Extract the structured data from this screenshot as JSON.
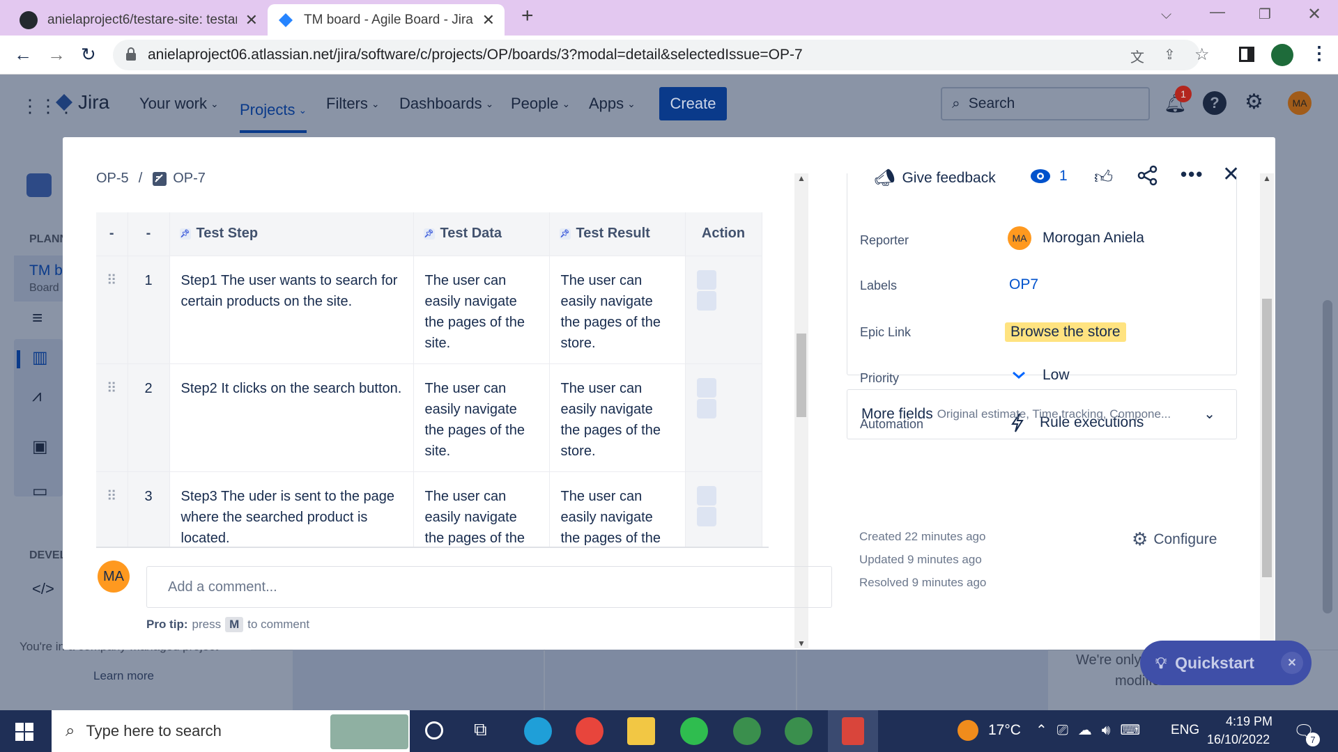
{
  "browser": {
    "tabs": [
      {
        "title": "anielaproject6/testare-site: testar",
        "active": false
      },
      {
        "title": "TM board - Agile Board - Jira",
        "active": true
      }
    ],
    "url": "anielaproject06.atlassian.net/jira/software/c/projects/OP/boards/3?modal=detail&selectedIssue=OP-7"
  },
  "jira_header": {
    "logo_text": "Jira",
    "nav": [
      "Your work",
      "Projects",
      "Filters",
      "Dashboards",
      "People",
      "Apps"
    ],
    "create_label": "Create",
    "search_placeholder": "Search",
    "notification_count": "1",
    "avatar_initials": "MA"
  },
  "sidebar_bg": {
    "planning_label": "PLANN",
    "board_title": "TM b",
    "board_sub": "Board",
    "dev_label": "DEVEL",
    "footer_text": "You're in a company-managed project",
    "learn_more": "Learn more"
  },
  "modal": {
    "breadcrumb_parent": "OP-5",
    "breadcrumb_sep": "/",
    "breadcrumb_issue": "OP-7",
    "give_feedback": "Give feedback",
    "watchers": "1",
    "table": {
      "headers": [
        "-",
        "-",
        "Test Step",
        "Test Data",
        "Test Result",
        "Action"
      ],
      "rows": [
        {
          "num": "1",
          "step": "Step1 The user wants to search for certain products on the site.",
          "data": "The user can easily navigate the pages of the site.",
          "result": "The user can easily navigate the pages of the store."
        },
        {
          "num": "2",
          "step": "Step2 It clicks on the search button.",
          "data": "The user can easily navigate the pages of the site.",
          "result": "The user can easily navigate the pages of the store."
        },
        {
          "num": "3",
          "step": "Step3 The uder is sent to the page where the searched product is located.",
          "data": "The user can easily navigate the pages of the",
          "result": "The user can easily navigate the pages of the"
        }
      ]
    },
    "comment": {
      "avatar": "MA",
      "placeholder": "Add a comment...",
      "protip_label": "Pro tip:",
      "protip_press": "press",
      "protip_key": "M",
      "protip_rest": "to comment"
    },
    "fields": {
      "reporter_label": "Reporter",
      "reporter_avatar": "MA",
      "reporter_value": "Morogan Aniela",
      "labels_label": "Labels",
      "labels_value": "OP7",
      "epic_label": "Epic Link",
      "epic_value": "Browse the store",
      "priority_label": "Priority",
      "priority_value": "Low",
      "automation_label": "Automation",
      "automation_value": "Rule executions"
    },
    "more_fields": {
      "title": "More fields",
      "hint": "Original estimate, Time tracking, Compone..."
    },
    "meta": {
      "created": "Created 22 minutes ago",
      "updated": "Updated 9 minutes ago",
      "resolved": "Resolved 9 minutes ago",
      "configure": "Configure"
    }
  },
  "quickstart": {
    "label": "Quickstart",
    "bg_text_1": "We're only",
    "bg_text_2": "modified issue."
  },
  "taskbar": {
    "search_placeholder": "Type here to search",
    "weather": "17°C",
    "lang": "ENG",
    "time": "4:19 PM",
    "date": "16/10/2022",
    "notification_count": "7"
  },
  "colors": {
    "jira_blue": "#0052cc",
    "epic_yellow": "#ffe380",
    "avatar_orange": "#ff991f",
    "tab_bar": "#e3c8f0",
    "quickstart": "#3f4fa8"
  }
}
